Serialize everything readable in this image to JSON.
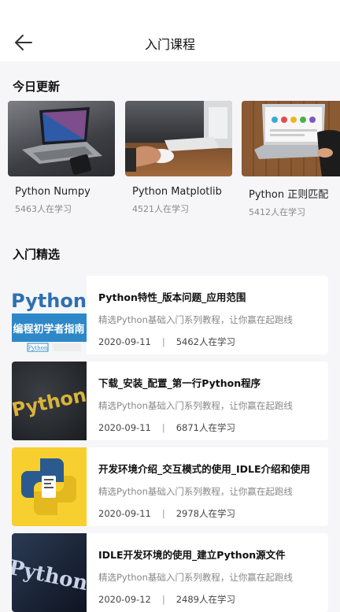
{
  "header": {
    "title": "入门课程"
  },
  "today": {
    "heading": "今日更新",
    "items": [
      {
        "name": "Python Numpy",
        "count": "5463人在学习"
      },
      {
        "name": "Python Matplotlib",
        "count": "4521人在学习"
      },
      {
        "name": "Python 正则匹配",
        "count": "5412人在学习"
      }
    ]
  },
  "featured": {
    "heading": "入门精选",
    "courses": [
      {
        "title": "Python特性_版本问题_应用范围",
        "desc": "精选Python基础入门系列教程，让你赢在起跑线",
        "date": "2020-09-11",
        "sep": "|",
        "count": "5462人在学习",
        "img": {
          "top": "Python",
          "mid": "编程初学者指南",
          "small": "Python"
        }
      },
      {
        "title": "下载_安装_配置_第一行Python程序",
        "desc": "精选Python基础入门系列教程，让你赢在起跑线",
        "date": "2020-09-11",
        "sep": "|",
        "count": "6871人在学习",
        "img": {
          "top": "Python"
        }
      },
      {
        "title": "开发环境介绍_交互模式的使用_IDLE介绍和使用",
        "desc": "精选Python基础入门系列教程，让你赢在起跑线",
        "date": "2020-09-11",
        "sep": "|",
        "count": "2978人在学习"
      },
      {
        "title": "IDLE开发环境的使用_建立Python源文件",
        "desc": "精选Python基础入门系列教程，让你赢在起跑线",
        "date": "2020-09-12",
        "sep": "|",
        "count": "2489人在学习",
        "img": {
          "top": "Python"
        }
      }
    ]
  }
}
